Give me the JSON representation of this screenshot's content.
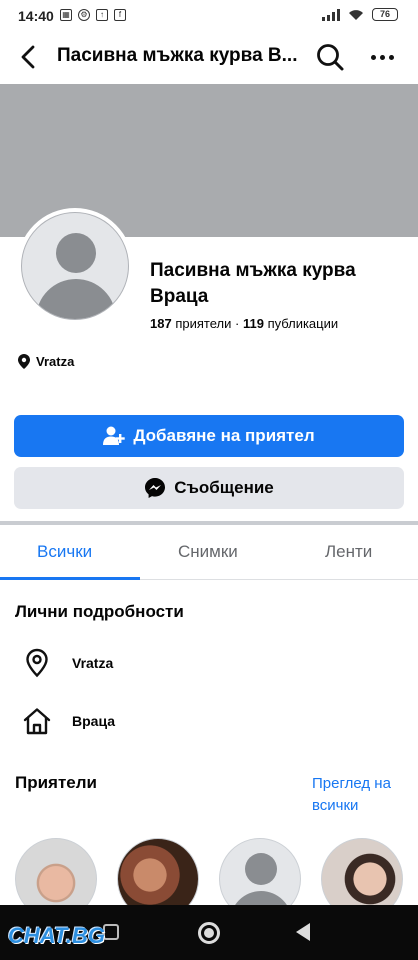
{
  "status_bar": {
    "time": "14:40",
    "battery": "76"
  },
  "top_bar": {
    "title": "Пасивна мъжка курва В..."
  },
  "profile": {
    "name": "Пасивна мъжка курва Враца",
    "friends_count": "187",
    "friends_label": "приятели",
    "separator": "·",
    "posts_count": "119",
    "posts_label": "публикации",
    "location": "Vratza"
  },
  "actions": {
    "add_friend": "Добавяне на приятел",
    "message": "Съобщение"
  },
  "tabs": [
    {
      "label": "Всички",
      "active": true
    },
    {
      "label": "Снимки",
      "active": false
    },
    {
      "label": "Ленти",
      "active": false
    }
  ],
  "details": {
    "title": "Лични подробности",
    "items": [
      {
        "icon": "location-pin-icon",
        "label": "Vratza"
      },
      {
        "icon": "home-icon",
        "label": "Враца"
      }
    ]
  },
  "friends": {
    "title": "Приятели",
    "see_all": "Преглед на всички"
  },
  "watermark": "CHAT.BG",
  "colors": {
    "accent": "#1877f2",
    "cover": "#a9abae",
    "secondary_button": "#e4e6eb"
  }
}
